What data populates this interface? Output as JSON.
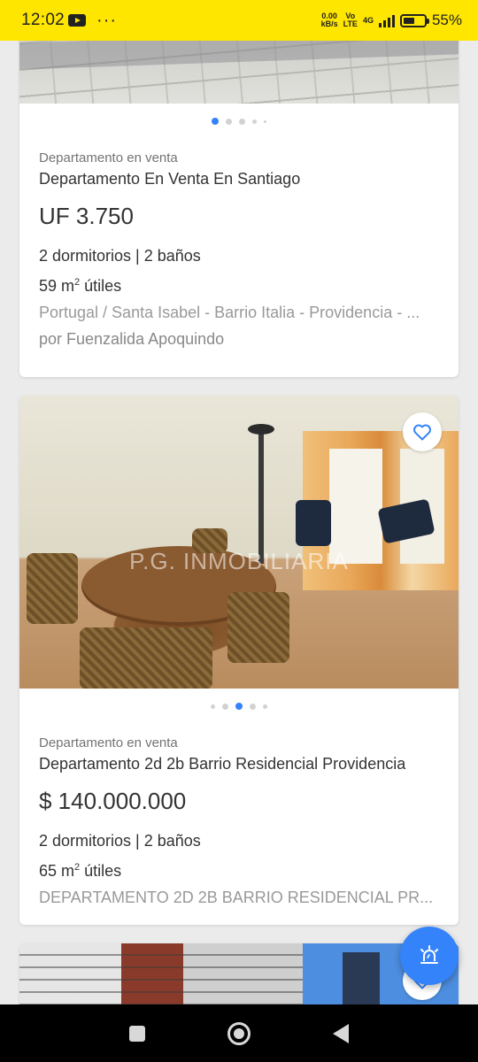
{
  "status_bar": {
    "time": "12:02",
    "more": "···",
    "net_speed_value": "0.00",
    "net_speed_unit": "kB/s",
    "volte": "Vo",
    "lte": "LTE",
    "network": "4G",
    "battery_level": 0.55,
    "battery_pct": "55%"
  },
  "listings": [
    {
      "kind": "Departamento en venta",
      "title": "Departamento En Venta En Santiago",
      "price": "UF 3.750",
      "rooms": "2 dormitorios | 2 baños",
      "area_value": "59 m",
      "area_sup": "2",
      "area_suffix": " útiles",
      "address": "Portugal / Santa Isabel - Barrio Italia - Providencia - ...",
      "seller": "por Fuenzalida Apoquindo",
      "active_photo_index": 0,
      "photo_count": 5
    },
    {
      "kind": "Departamento en venta",
      "title": "Departamento 2d 2b Barrio Residencial Providencia",
      "price": "$ 140.000.000",
      "rooms": "2 dormitorios | 2 baños",
      "area_value": "65 m",
      "area_sup": "2",
      "area_suffix": " útiles",
      "description": "DEPARTAMENTO 2D 2B BARRIO RESIDENCIAL PR...",
      "watermark": "P.G. INMOBILIARIA",
      "active_photo_index": 2,
      "photo_count": 5
    }
  ],
  "icons": {
    "favorite": "heart-outline-icon",
    "alert": "siren-alert-icon"
  },
  "colors": {
    "status_bar": "#ffe600",
    "accent": "#3483fa",
    "background": "#ebebeb"
  }
}
